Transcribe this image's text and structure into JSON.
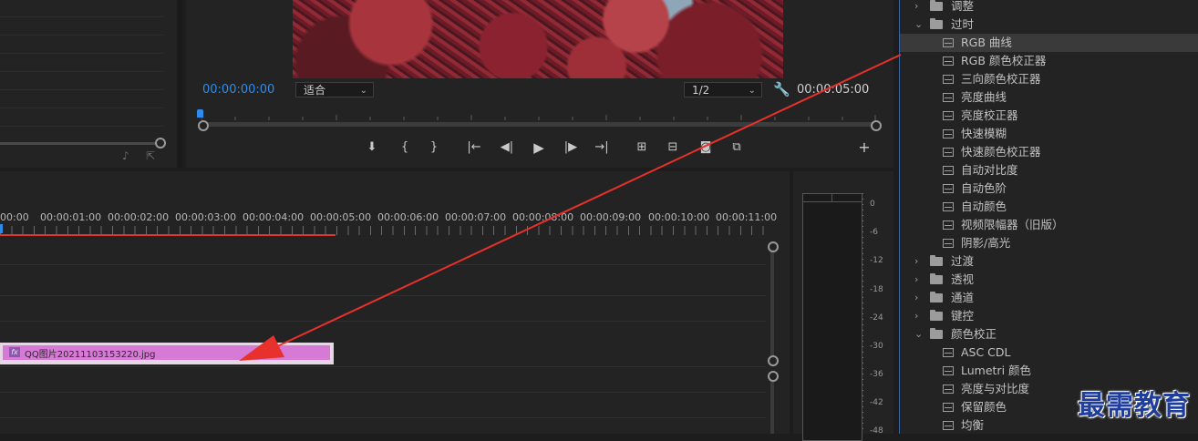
{
  "program_monitor": {
    "timecode_current": "00:00:00:00",
    "fit_select": "适合",
    "resolution_select": "1/2",
    "timecode_duration": "00:00:05:00"
  },
  "timeline": {
    "ruler_labels": [
      "00:00",
      "00:00:01:00",
      "00:00:02:00",
      "00:00:03:00",
      "00:00:04:00",
      "00:00:05:00",
      "00:00:06:00",
      "00:00:07:00",
      "00:00:08:00",
      "00:00:09:00",
      "00:00:10:00",
      "00:00:11:00"
    ],
    "clip": {
      "name": "QQ图片20211103153220.jpg",
      "badge": "fx"
    }
  },
  "audio_meter": {
    "db_labels": [
      "0",
      "-6",
      "-12",
      "-18",
      "-24",
      "-30",
      "-36",
      "-42",
      "-48"
    ]
  },
  "effects": {
    "items": [
      {
        "type": "folder",
        "state": "collapsed",
        "label": "调整"
      },
      {
        "type": "folder",
        "state": "expanded",
        "label": "过时"
      },
      {
        "type": "preset",
        "label": "RGB 曲线",
        "selected": true
      },
      {
        "type": "preset",
        "label": "RGB 颜色校正器"
      },
      {
        "type": "preset",
        "label": "三向颜色校正器"
      },
      {
        "type": "preset",
        "label": "亮度曲线"
      },
      {
        "type": "preset",
        "label": "亮度校正器"
      },
      {
        "type": "preset",
        "label": "快速模糊"
      },
      {
        "type": "preset",
        "label": "快速颜色校正器"
      },
      {
        "type": "preset",
        "label": "自动对比度"
      },
      {
        "type": "preset",
        "label": "自动色阶"
      },
      {
        "type": "preset",
        "label": "自动颜色"
      },
      {
        "type": "preset",
        "label": "视频限幅器（旧版）"
      },
      {
        "type": "preset",
        "label": "阴影/高光"
      },
      {
        "type": "folder",
        "state": "collapsed",
        "label": "过渡"
      },
      {
        "type": "folder",
        "state": "collapsed",
        "label": "透视"
      },
      {
        "type": "folder",
        "state": "collapsed",
        "label": "通道"
      },
      {
        "type": "folder",
        "state": "collapsed",
        "label": "键控"
      },
      {
        "type": "folder",
        "state": "expanded",
        "label": "颜色校正"
      },
      {
        "type": "preset",
        "label": "ASC CDL"
      },
      {
        "type": "preset",
        "label": "Lumetri 颜色"
      },
      {
        "type": "preset",
        "label": "亮度与对比度"
      },
      {
        "type": "preset",
        "label": "保留颜色"
      },
      {
        "type": "preset",
        "label": "均衡"
      }
    ]
  },
  "watermark": "最需教育",
  "colors": {
    "timecode_blue": "#2d8ceb",
    "clip_fill": "#d67ad6",
    "annotation_arrow": "#e8302c",
    "selection": "#3a3a3a"
  }
}
